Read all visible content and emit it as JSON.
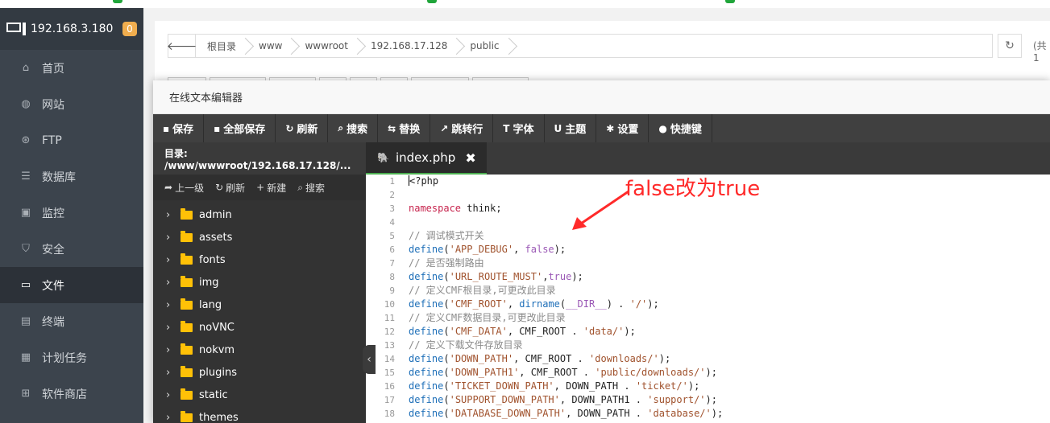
{
  "sidebar": {
    "server_ip": "192.168.3.180",
    "badge": "0",
    "items": [
      {
        "label": "首页",
        "icon": "home-icon"
      },
      {
        "label": "网站",
        "icon": "globe-icon"
      },
      {
        "label": "FTP",
        "icon": "ftp-icon"
      },
      {
        "label": "数据库",
        "icon": "database-icon"
      },
      {
        "label": "监控",
        "icon": "monitor-icon"
      },
      {
        "label": "安全",
        "icon": "shield-icon"
      },
      {
        "label": "文件",
        "icon": "folder-icon"
      },
      {
        "label": "终端",
        "icon": "terminal-icon"
      },
      {
        "label": "计划任务",
        "icon": "schedule-icon"
      },
      {
        "label": "软件商店",
        "icon": "apps-icon"
      }
    ],
    "active_index": 6
  },
  "pathbar": {
    "crumbs": [
      "根目录",
      "www",
      "wwwroot",
      "192.168.17.128",
      "public"
    ],
    "right_text": "(共1"
  },
  "editor": {
    "title": "在线文本编辑器",
    "toolbar": [
      {
        "icon": "save-icon",
        "label": "保存"
      },
      {
        "icon": "save-all-icon",
        "label": "全部保存"
      },
      {
        "icon": "refresh-icon",
        "label": "刷新"
      },
      {
        "icon": "search-icon",
        "label": "搜索"
      },
      {
        "icon": "replace-icon",
        "label": "替换"
      },
      {
        "icon": "goto-line-icon",
        "label": "跳转行"
      },
      {
        "icon": "font-icon",
        "label": "字体"
      },
      {
        "icon": "theme-icon",
        "label": "主题"
      },
      {
        "icon": "gear-icon",
        "label": "设置"
      },
      {
        "icon": "help-icon",
        "label": "快捷键"
      }
    ],
    "tree_path": "目录: /www/wwwroot/192.168.17.128/...",
    "tree_actions": [
      {
        "icon": "up-icon",
        "label": "上一级"
      },
      {
        "icon": "refresh-icon",
        "label": "刷新"
      },
      {
        "icon": "plus-icon",
        "label": "新建"
      },
      {
        "icon": "search-icon",
        "label": "搜索"
      }
    ],
    "folders": [
      "admin",
      "assets",
      "fonts",
      "img",
      "lang",
      "noVNC",
      "nokvm",
      "plugins",
      "static",
      "themes"
    ],
    "tab": {
      "filename": "index.php",
      "close": "✖"
    },
    "annotation": "false改为true",
    "line_numbers": [
      "1",
      "2",
      "3",
      "4",
      "5",
      "6",
      "7",
      "8",
      "9",
      "10",
      "11",
      "12",
      "13",
      "14",
      "15",
      "16",
      "17",
      "18"
    ],
    "code": {
      "l1": "<?php",
      "l3_kw": "namespace",
      "l3_rest": " think;",
      "l5": "// 调试模式开关",
      "l6_fn": "define",
      "l6_s": "'APP_DEBUG'",
      "l6_b": "false",
      "l7": "// 是否强制路由",
      "l8_s": "'URL_ROUTE_MUST'",
      "l8_b": "true",
      "l9": "// 定义CMF根目录,可更改此目录",
      "l10_s": "'CMF_ROOT'",
      "l10_fn2": "dirname",
      "l10_b": "__DIR__",
      "l10_s2": "'/'",
      "l11": "// 定义CMF数据目录,可更改此目录",
      "l12_s": "'CMF_DATA'",
      "l12_c": "CMF_ROOT",
      "l12_s2": "'data/'",
      "l13": "// 定义下载文件存放目录",
      "l14_s": "'DOWN_PATH'",
      "l14_c": "CMF_ROOT",
      "l14_s2": "'downloads/'",
      "l15_s": "'DOWN_PATH1'",
      "l15_c": "CMF_ROOT",
      "l15_s2": "'public/downloads/'",
      "l16_s": "'TICKET_DOWN_PATH'",
      "l16_c": "DOWN_PATH",
      "l16_s2": "'ticket/'",
      "l17_s": "'SUPPORT_DOWN_PATH'",
      "l17_c": "DOWN_PATH1",
      "l17_s2": "'support/'",
      "l18_s": "'DATABASE_DOWN_PATH'",
      "l18_c": "DOWN_PATH",
      "l18_s2": "'database/'"
    }
  },
  "colors": {
    "sidebar_bg": "#3c444d",
    "accent": "#20a53a",
    "badge": "#f0ad4e",
    "annotation": "#ff2a2a"
  }
}
